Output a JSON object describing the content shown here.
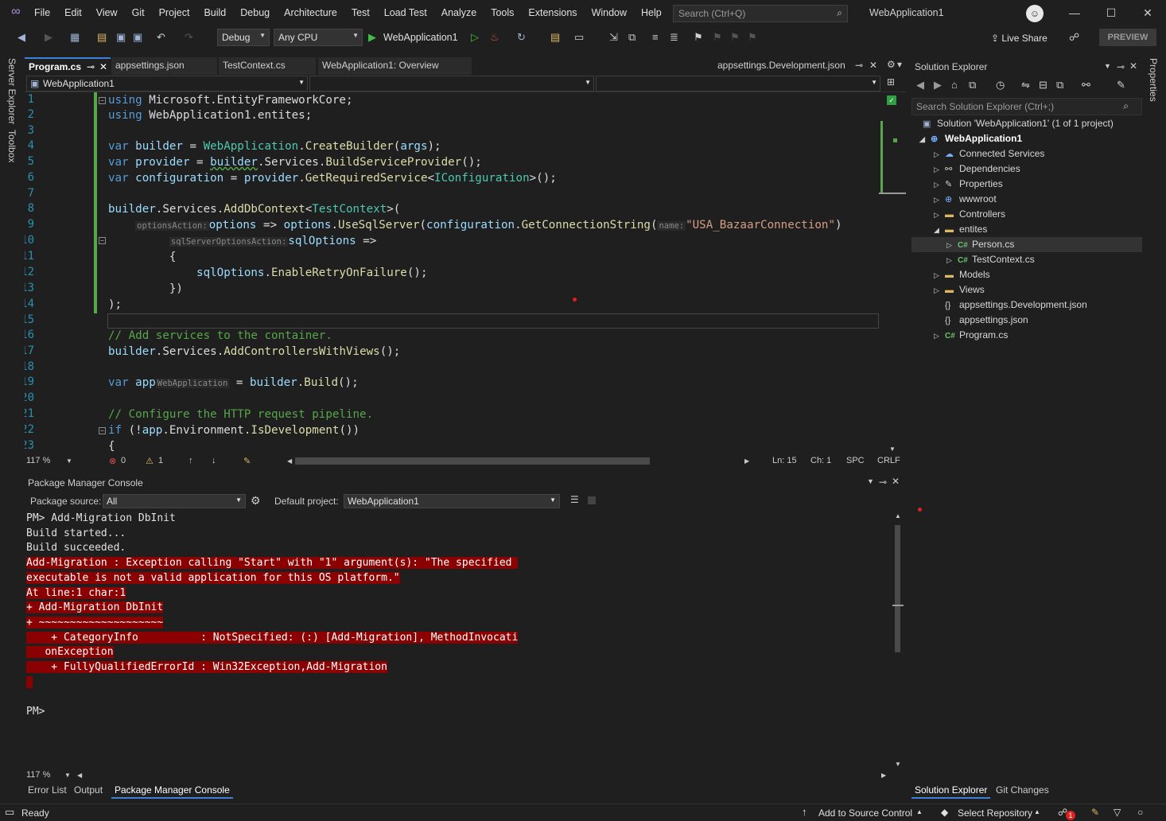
{
  "menu": {
    "items": [
      "File",
      "Edit",
      "View",
      "Git",
      "Project",
      "Build",
      "Debug",
      "Architecture",
      "Test",
      "Load Test",
      "Analyze",
      "Tools",
      "Extensions",
      "Window",
      "Help"
    ],
    "search_placeholder": "Search (Ctrl+Q)",
    "app_title": "WebApplication1"
  },
  "toolbar": {
    "config": "Debug",
    "platform": "Any CPU",
    "run_target": "WebApplication1",
    "live_share": "Live Share",
    "preview": "PREVIEW"
  },
  "left_rail": {
    "server_explorer": "Server Explorer",
    "toolbox": "Toolbox"
  },
  "right_rail": {
    "properties": "Properties"
  },
  "doc_tabs": [
    {
      "label": "Program.cs"
    },
    {
      "label": "appsettings.json"
    },
    {
      "label": "TestContext.cs"
    },
    {
      "label": "WebApplication1: Overview"
    },
    {
      "label": "appsettings.Development.json"
    }
  ],
  "nav_bar": {
    "project": "WebApplication1"
  },
  "editor": {
    "line_numbers": [
      "1",
      "2",
      "3",
      "4",
      "5",
      "6",
      "7",
      "8",
      "9",
      "10",
      "11",
      "12",
      "13",
      "14",
      "15",
      "16",
      "17",
      "18",
      "19",
      "20",
      "21",
      "22",
      "23"
    ],
    "hints": {
      "options_action": "optionsAction:",
      "name": "name:",
      "sql_server_options_action": "sqlServerOptionsAction:",
      "web_application": "WebApplication"
    },
    "tokens": {
      "using": "using",
      "ns1": "Microsoft.EntityFrameworkCore",
      "ns2": "WebApplication1.entites",
      "semi": ";",
      "var": "var",
      "builder": "builder",
      "provider": "provider",
      "configuration": "configuration",
      "eq": " = ",
      "WebApplication": "WebApplication",
      "CreateBuilder": "CreateBuilder",
      "args": "args",
      "Services": "Services",
      "BuildServiceProvider": "BuildServiceProvider",
      "GetRequiredService": "GetRequiredService",
      "IConfiguration": "IConfiguration",
      "AddDbContext": "AddDbContext",
      "TestContext": "TestContext",
      "options": "options",
      "arrow": " => ",
      "UseSqlServer": "UseSqlServer",
      "GetConnectionString": "GetConnectionString",
      "conn_str": "\"USA_BazaarConnection\"",
      "sqlOptions": "sqlOptions",
      "open_brace": "{",
      "EnableRetryOnFailure": "EnableRetryOnFailure",
      "close_brace_paren": "})",
      "close_paren_semi": ");",
      "comment1": "// Add services to the container.",
      "AddControllersWithViews": "AddControllersWithViews",
      "app": "app",
      "Build": "Build",
      "comment2": "// Configure the HTTP request pipeline.",
      "if": "if",
      "Environment": "Environment",
      "IsDevelopment": "IsDevelopment"
    }
  },
  "editor_status": {
    "zoom": "117 %",
    "errors": "0",
    "warnings": "1",
    "ln": "Ln: 15",
    "ch": "Ch: 1",
    "spc": "SPC",
    "crlf": "CRLF"
  },
  "pmc": {
    "title": "Package Manager Console",
    "source_label": "Package source:",
    "source_value": "All",
    "default_project_label": "Default project:",
    "default_project_value": "WebApplication1",
    "lines": [
      {
        "text": "PM> Add-Migration DbInit",
        "err": false
      },
      {
        "text": "Build started...",
        "err": false
      },
      {
        "text": "Build succeeded.",
        "err": false
      },
      {
        "text": "Add-Migration : Exception calling \"Start\" with \"1\" argument(s): \"The specified ",
        "err": true
      },
      {
        "text": "executable is not a valid application for this OS platform.\"",
        "err": true
      },
      {
        "text": "At line:1 char:1",
        "err": true
      },
      {
        "text": "+ Add-Migration DbInit",
        "err": true
      },
      {
        "text": "+ ~~~~~~~~~~~~~~~~~~~~",
        "err": true
      },
      {
        "text": "    + CategoryInfo          : NotSpecified: (:) [Add-Migration], MethodInvocati",
        "err": true
      },
      {
        "text": "   onException",
        "err": true
      },
      {
        "text": "    + FullyQualifiedErrorId : Win32Exception,Add-Migration",
        "err": true
      },
      {
        "text": " ",
        "err": true
      },
      {
        "text": "",
        "err": false
      },
      {
        "text": "PM>",
        "err": false
      }
    ],
    "zoom": "117 %"
  },
  "bottom_tabs": [
    "Error List",
    "Output",
    "Package Manager Console"
  ],
  "solution_explorer": {
    "title": "Solution Explorer",
    "search_placeholder": "Search Solution Explorer (Ctrl+;)",
    "solution": "Solution 'WebApplication1' (1 of 1 project)",
    "project": "WebApplication1",
    "items": [
      {
        "label": "Connected Services",
        "level": 2,
        "arrow": "right",
        "icon": "connected-services-icon"
      },
      {
        "label": "Dependencies",
        "level": 2,
        "arrow": "right",
        "icon": "dependencies-icon"
      },
      {
        "label": "Properties",
        "level": 2,
        "arrow": "right",
        "icon": "properties-icon"
      },
      {
        "label": "wwwroot",
        "level": 2,
        "arrow": "right",
        "icon": "globe-icon"
      },
      {
        "label": "Controllers",
        "level": 2,
        "arrow": "right",
        "icon": "folder-icon"
      },
      {
        "label": "entites",
        "level": 2,
        "arrow": "down",
        "icon": "folder-icon"
      },
      {
        "label": "Person.cs",
        "level": 3,
        "arrow": "right",
        "icon": "csharp-icon"
      },
      {
        "label": "TestContext.cs",
        "level": 3,
        "arrow": "right",
        "icon": "csharp-icon"
      },
      {
        "label": "Models",
        "level": 2,
        "arrow": "right",
        "icon": "folder-icon"
      },
      {
        "label": "Views",
        "level": 2,
        "arrow": "right",
        "icon": "folder-icon"
      },
      {
        "label": "appsettings.Development.json",
        "level": 2,
        "arrow": "none",
        "icon": "json-icon"
      },
      {
        "label": "appsettings.json",
        "level": 2,
        "arrow": "none",
        "icon": "json-icon"
      },
      {
        "label": "Program.cs",
        "level": 2,
        "arrow": "right",
        "icon": "csharp-icon"
      }
    ],
    "tabs": [
      "Solution Explorer",
      "Git Changes"
    ]
  },
  "status_bar": {
    "ready": "Ready",
    "add_source": "Add to Source Control",
    "select_repo": "Select Repository",
    "notifications": "1"
  },
  "colors": {
    "accent": "#3f7fd8",
    "error_bg": "#8b0000",
    "change_bar": "#57a64a"
  }
}
